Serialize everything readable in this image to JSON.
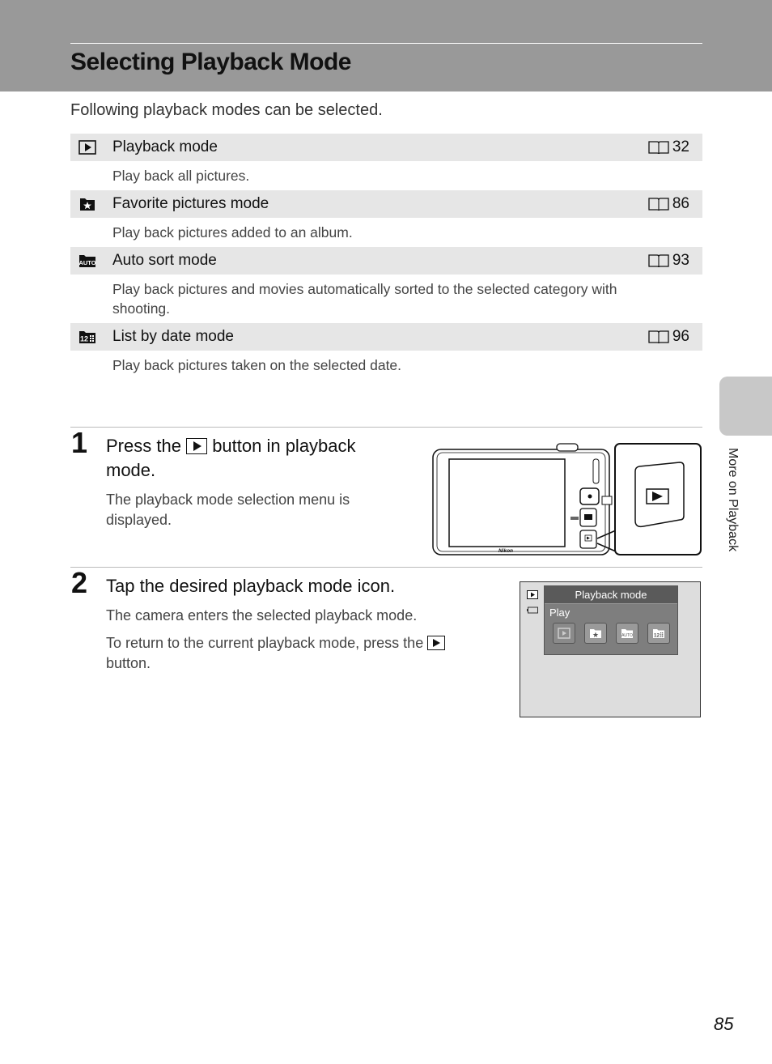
{
  "header": {
    "title": "Selecting Playback Mode"
  },
  "intro": "Following playback modes can be selected.",
  "modes": [
    {
      "icon": "playback-icon",
      "name": "Playback mode",
      "ref_icon": "book-icon",
      "ref_page": "32",
      "description": "Play back all pictures."
    },
    {
      "icon": "favorite-pictures-icon",
      "name": "Favorite pictures mode",
      "ref_icon": "book-icon",
      "ref_page": "86",
      "description": "Play back pictures added to an album."
    },
    {
      "icon": "auto-sort-icon",
      "name": "Auto sort mode",
      "ref_icon": "book-icon",
      "ref_page": "93",
      "description": "Play back pictures and movies automatically sorted to the selected category with shooting."
    },
    {
      "icon": "list-by-date-icon",
      "name": "List by date mode",
      "ref_icon": "book-icon",
      "ref_page": "96",
      "description": "Play back pictures taken on the selected date."
    }
  ],
  "steps": [
    {
      "number": "1",
      "title_before": "Press the",
      "title_after": "button in playback mode.",
      "text": "The playback mode selection menu is displayed."
    },
    {
      "number": "2",
      "title": "Tap the desired playback mode icon.",
      "text1": "The camera enters the selected playback mode.",
      "text2_before": "To return to the current playback mode, press the",
      "text2_after": "button."
    }
  ],
  "camera_illustration": {
    "brand": "Nikon"
  },
  "screen_illustration": {
    "menu_title": "Playback mode",
    "menu_subtitle": "Play",
    "menu_icons": [
      "playback-icon",
      "favorite-pictures-icon",
      "auto-sort-icon",
      "list-by-date-icon"
    ],
    "auto_label": "AUTO",
    "date_label": "12"
  },
  "side_tab": {
    "label": "More on Playback"
  },
  "page_number": "85"
}
